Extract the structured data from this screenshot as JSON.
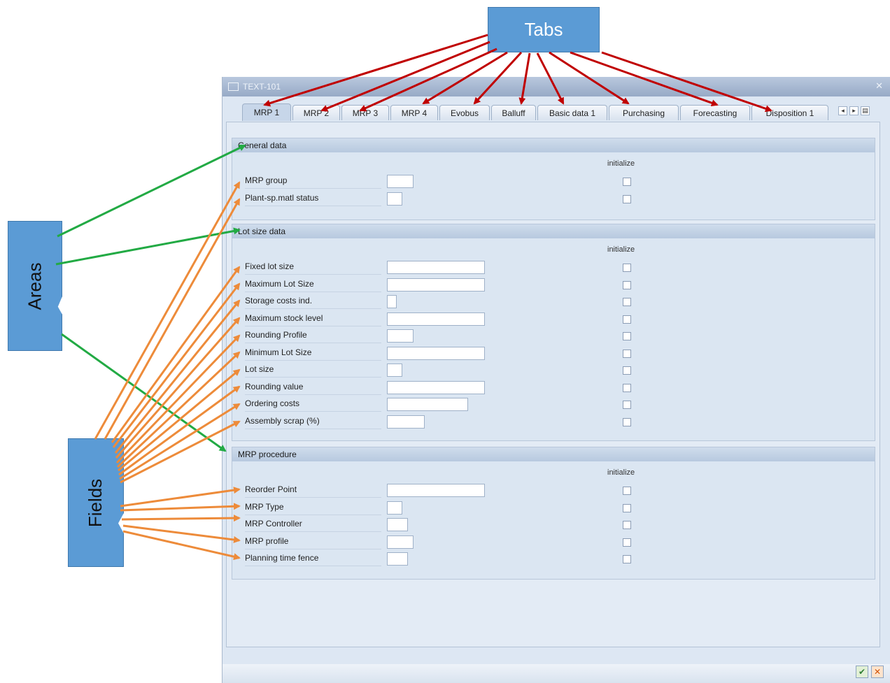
{
  "callouts": {
    "tabs": "Tabs",
    "areas": "Areas",
    "fields": "Fields"
  },
  "window": {
    "title": "TEXT-101"
  },
  "tabs": [
    "MRP 1",
    "MRP 2",
    "MRP 3",
    "MRP 4",
    "Evobus",
    "Balluff",
    "Basic data 1",
    "Purchasing",
    "Forecasting",
    "Disposition 1"
  ],
  "groups": {
    "general": {
      "title": "General data",
      "initialize": "initialize",
      "fields": [
        "MRP group",
        "Plant-sp.matl status"
      ]
    },
    "lotsize": {
      "title": "Lot size data",
      "initialize": "initialize",
      "fields": [
        "Fixed lot size",
        "Maximum Lot Size",
        "Storage costs ind.",
        "Maximum stock level",
        "Rounding Profile",
        "Minimum Lot Size",
        "Lot size",
        "Rounding value",
        "Ordering costs",
        "Assembly scrap (%)"
      ]
    },
    "procedure": {
      "title": "MRP procedure",
      "initialize": "initialize",
      "fields": [
        "Reorder Point",
        "MRP Type",
        "MRP Controller",
        "MRP profile",
        "Planning time fence"
      ]
    }
  },
  "colors": {
    "tab_arrow": "#c00000",
    "area_arrow": "#22aa44",
    "field_arrow": "#ed8b3a",
    "callout": "#5b9bd5"
  },
  "icons": [
    "window-icon",
    "close-icon",
    "tab-scroll-left-icon",
    "tab-scroll-right-icon",
    "tab-list-icon",
    "confirm-icon",
    "cancel-icon"
  ]
}
